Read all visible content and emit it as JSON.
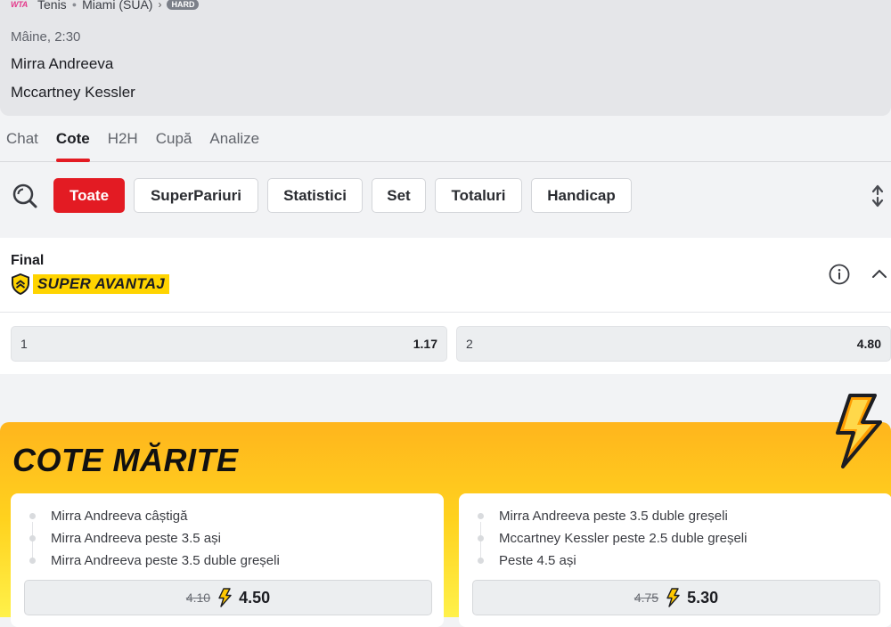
{
  "header": {
    "league_logo": "WTA",
    "sport": "Tenis",
    "tournament": "Miami (SUA)",
    "surface": "HARD",
    "start_time": "Mâine, 2:30",
    "player1": "Mirra Andreeva",
    "player2": "Mccartney Kessler"
  },
  "tabs": [
    {
      "label": "Chat",
      "active": false
    },
    {
      "label": "Cote",
      "active": true
    },
    {
      "label": "H2H",
      "active": false
    },
    {
      "label": "Cupă",
      "active": false
    },
    {
      "label": "Analize",
      "active": false
    }
  ],
  "filters": [
    {
      "label": "Toate",
      "active": true
    },
    {
      "label": "SuperPariuri",
      "active": false
    },
    {
      "label": "Statistici",
      "active": false
    },
    {
      "label": "Set",
      "active": false
    },
    {
      "label": "Totaluri",
      "active": false
    },
    {
      "label": "Handicap",
      "active": false
    }
  ],
  "market": {
    "title": "Final",
    "badge": "SUPER AVANTAJ",
    "outcomes": [
      {
        "label": "1",
        "odd": "1.17"
      },
      {
        "label": "2",
        "odd": "4.80"
      }
    ]
  },
  "boosted": {
    "title": "COTE MĂRITE",
    "cards": [
      {
        "legs": [
          "Mirra Andreeva câștigă",
          "Mirra Andreeva peste 3.5 ași",
          "Mirra Andreeva peste 3.5 duble greșeli"
        ],
        "old_odd": "4.10",
        "new_odd": "4.50"
      },
      {
        "legs": [
          "Mirra Andreeva peste 3.5 duble greșeli",
          "Mccartney Kessler peste 2.5 duble greșeli",
          "Peste 4.5 ași"
        ],
        "old_odd": "4.75",
        "new_odd": "5.30"
      }
    ]
  },
  "colors": {
    "accent": "#e31b23",
    "badge_yellow": "#ffd400",
    "boost_gradient_top": "#ffb51d",
    "boost_gradient_bottom": "#fff14a"
  },
  "icons": [
    "search-icon",
    "sort-icon",
    "shield-icon",
    "info-icon",
    "chevron-up-icon",
    "lightning-icon"
  ]
}
